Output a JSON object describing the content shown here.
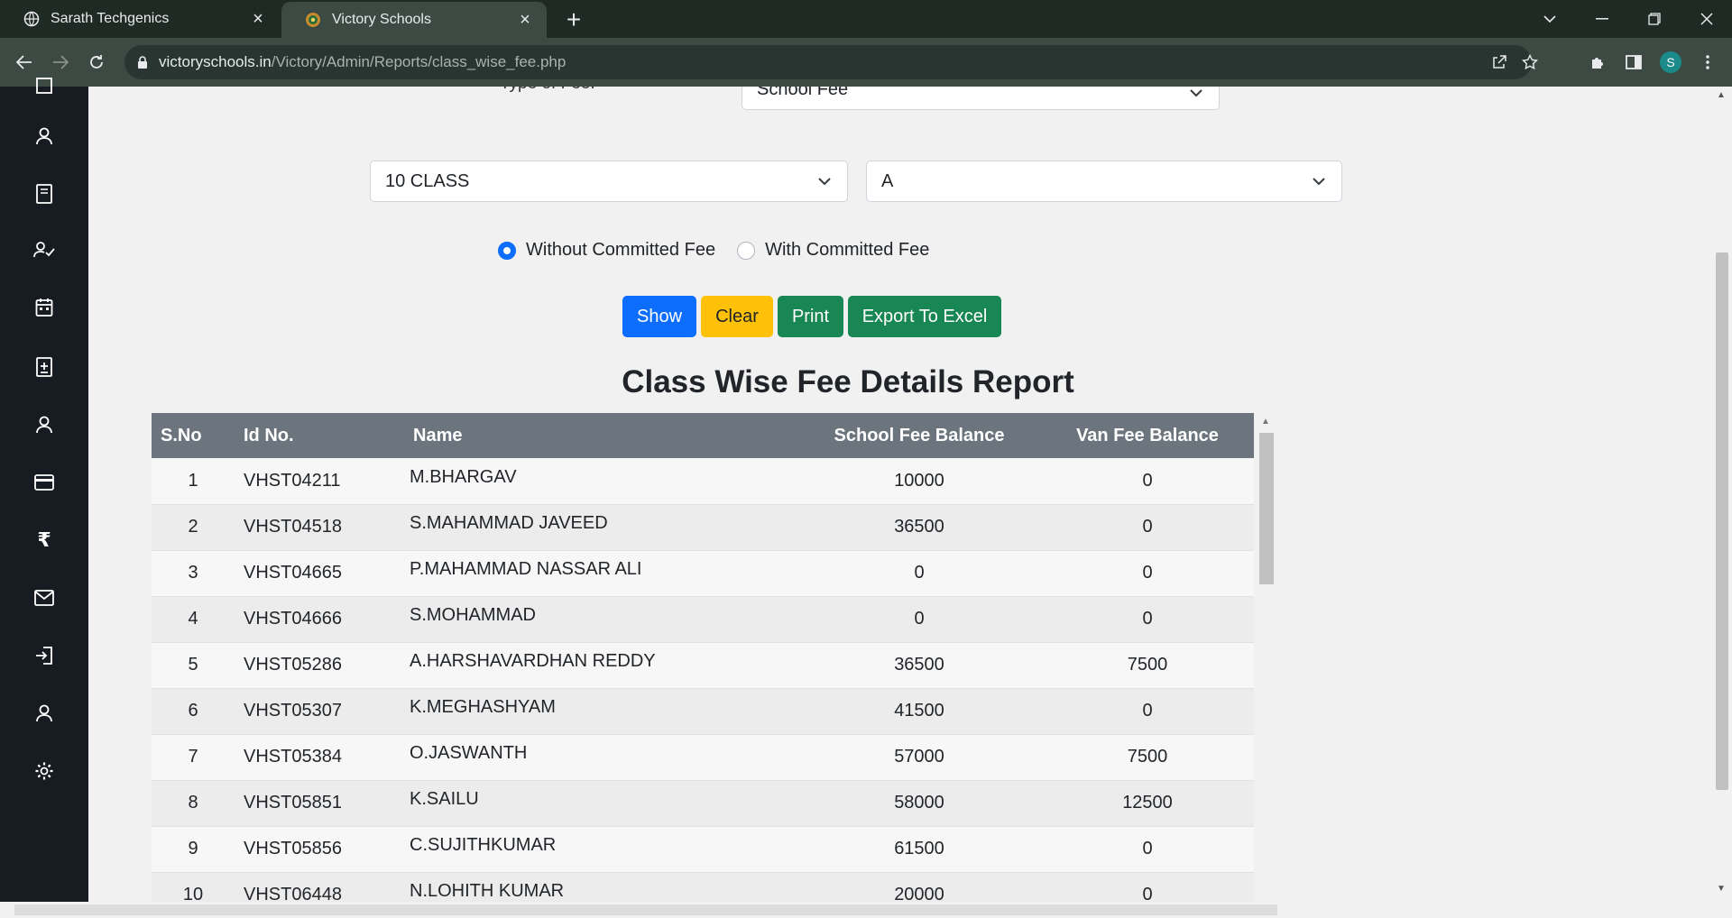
{
  "browser": {
    "tabs": [
      {
        "title": "Sarath Techgenics",
        "icon": "globe-icon",
        "active": false
      },
      {
        "title": "Victory Schools",
        "icon": "school-logo-icon",
        "active": true
      }
    ],
    "url_host": "victoryschools.in",
    "url_path": "/Victory/Admin/Reports/class_wise_fee.php",
    "profile_initial": "S"
  },
  "sidebar": {
    "icons": [
      "dashboard-icon",
      "user-icon",
      "book-icon",
      "user-check-icon",
      "calendar-icon",
      "add-document-icon",
      "person-icon",
      "card-icon",
      "rupee-icon",
      "mail-icon",
      "login-icon",
      "account-icon",
      "settings-icon"
    ]
  },
  "form": {
    "fee_type_label": "Type of Fee:",
    "fee_type_value": "School Fee",
    "class_value": "10 CLASS",
    "section_value": "A",
    "radio_without": "Without Committed Fee",
    "radio_with": "With Committed Fee",
    "selected_radio": "without"
  },
  "buttons": {
    "show": "Show",
    "clear": "Clear",
    "print": "Print",
    "export": "Export To Excel"
  },
  "report": {
    "title": "Class Wise Fee Details Report",
    "columns": [
      "S.No",
      "Id No.",
      "Name",
      "School Fee Balance",
      "Van Fee Balance"
    ],
    "rows": [
      [
        "1",
        "VHST04211",
        "M.BHARGAV",
        "10000",
        "0"
      ],
      [
        "2",
        "VHST04518",
        "S.MAHAMMAD JAVEED",
        "36500",
        "0"
      ],
      [
        "3",
        "VHST04665",
        "P.MAHAMMAD NASSAR ALI",
        "0",
        "0"
      ],
      [
        "4",
        "VHST04666",
        "S.MOHAMMAD",
        "0",
        "0"
      ],
      [
        "5",
        "VHST05286",
        "A.HARSHAVARDHAN REDDY",
        "36500",
        "7500"
      ],
      [
        "6",
        "VHST05307",
        "K.MEGHASHYAM",
        "41500",
        "0"
      ],
      [
        "7",
        "VHST05384",
        "O.JASWANTH",
        "57000",
        "7500"
      ],
      [
        "8",
        "VHST05851",
        "K.SAILU",
        "58000",
        "12500"
      ],
      [
        "9",
        "VHST05856",
        "C.SUJITHKUMAR",
        "61500",
        "0"
      ],
      [
        "10",
        "VHST06448",
        "N.LOHITH KUMAR",
        "20000",
        "0"
      ]
    ]
  },
  "colors": {
    "primary": "#0d6efd",
    "warning": "#ffc107",
    "success": "#198754",
    "table_header": "#6c757d",
    "sidebar": "#171c22"
  }
}
